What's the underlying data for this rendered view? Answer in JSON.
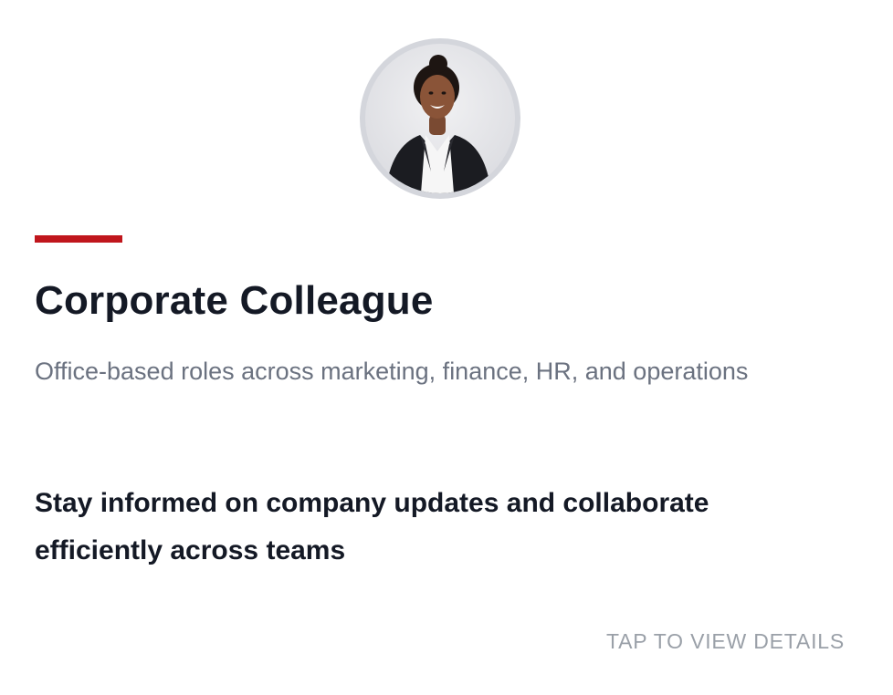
{
  "card": {
    "title": "Corporate Colleague",
    "subtitle": "Office-based roles across marketing, finance, HR, and operations",
    "description": "Stay informed on company updates and collaborate efficiently across teams",
    "cta_label": "TAP TO VIEW DETAILS",
    "accent_color": "#c0161c",
    "avatar": {
      "icon": "person-photo-avatar"
    }
  }
}
